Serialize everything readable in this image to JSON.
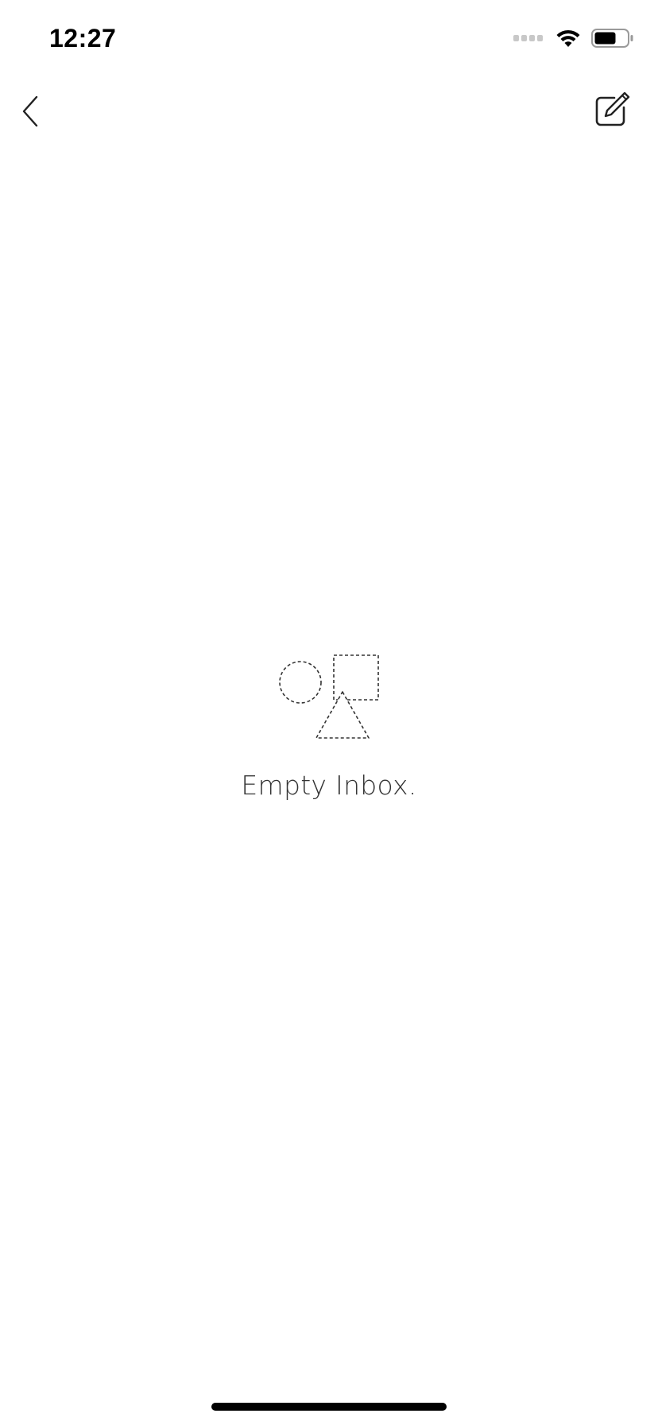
{
  "status_bar": {
    "time": "12:27",
    "icons": [
      "signal-dots-icon",
      "wifi-icon",
      "battery-icon"
    ]
  },
  "nav": {
    "back_icon": "chevron-left-icon",
    "compose_icon": "compose-icon"
  },
  "empty_state": {
    "illustration_icon": "shapes-placeholder-icon",
    "message": "Empty Inbox."
  },
  "colors": {
    "background": "#ffffff",
    "text": "#333333",
    "icon_stroke": "#222222",
    "status_dim": "#c8c8c8"
  }
}
